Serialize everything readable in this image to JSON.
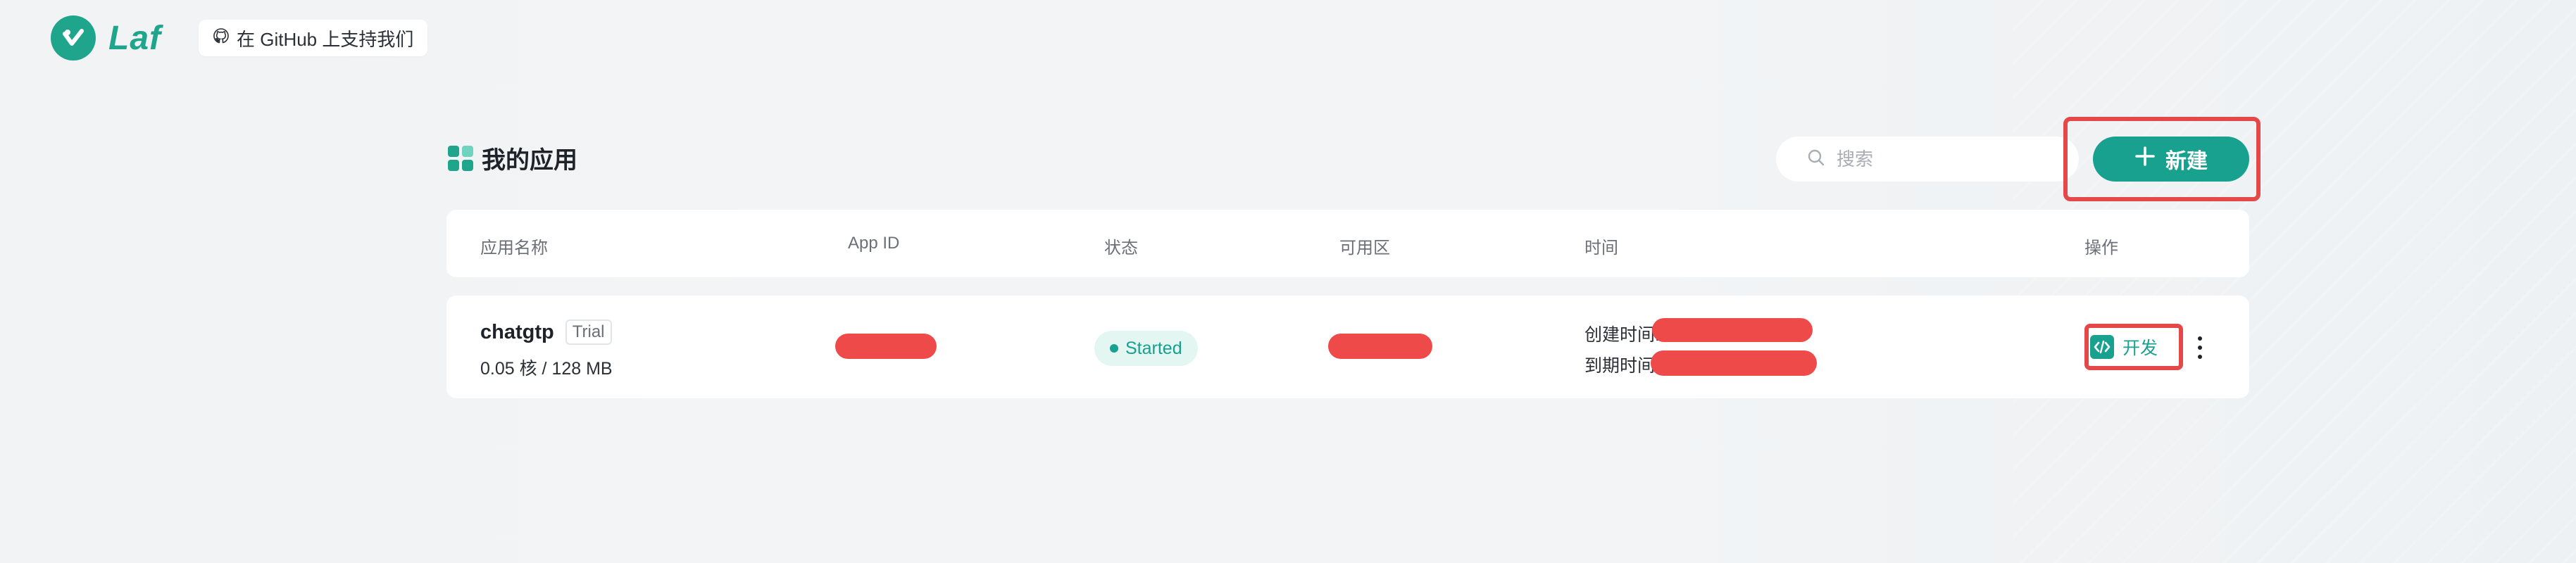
{
  "header": {
    "logo_text": "Laf",
    "github_button": "在 GitHub 上支持我们"
  },
  "main": {
    "title": "我的应用",
    "search_placeholder": "搜索",
    "new_button": "新建"
  },
  "table": {
    "columns": [
      "应用名称",
      "App ID",
      "状态",
      "可用区",
      "时间",
      "操作"
    ],
    "rows": [
      {
        "name": "chatgtp",
        "badge": "Trial",
        "spec": "0.05 核 / 128 MB",
        "status": "Started",
        "created_label": "创建时间:",
        "expires_label": "到期时间",
        "action_label": "开发"
      }
    ]
  },
  "colors": {
    "brand": "#1fa58c",
    "primary_button": "#17a18e",
    "highlight_border": "#e54848",
    "redaction": "#ef4a4a"
  },
  "icons": [
    "laf-logo-icon",
    "github-icon",
    "grid-icon",
    "search-icon",
    "plus-icon",
    "code-icon",
    "more-vertical-icon"
  ]
}
